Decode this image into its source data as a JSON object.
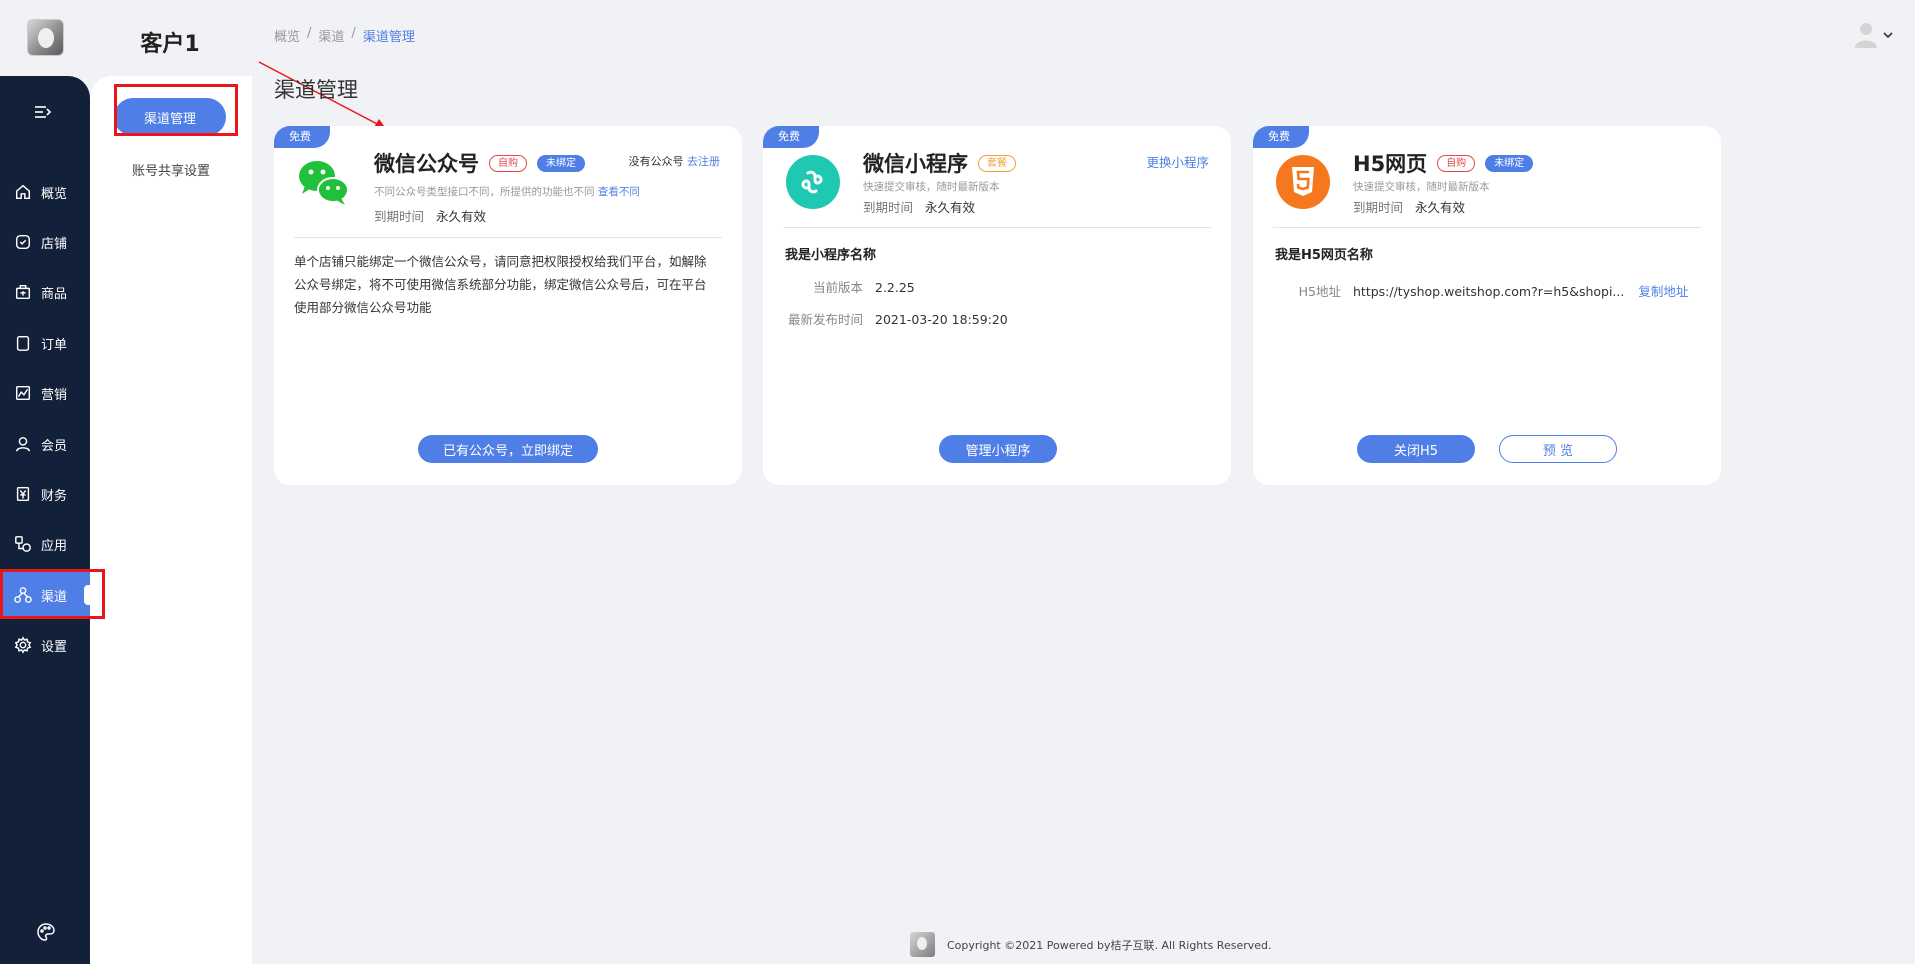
{
  "brand": {
    "store_name": "客户1"
  },
  "sidebar": {
    "items": [
      {
        "label": "概览",
        "icon": "home-icon"
      },
      {
        "label": "店铺",
        "icon": "shop-icon"
      },
      {
        "label": "商品",
        "icon": "goods-icon"
      },
      {
        "label": "订单",
        "icon": "order-icon"
      },
      {
        "label": "营销",
        "icon": "chart-icon"
      },
      {
        "label": "会员",
        "icon": "user-icon"
      },
      {
        "label": "财务",
        "icon": "yen-icon"
      },
      {
        "label": "应用",
        "icon": "apps-icon"
      },
      {
        "label": "渠道",
        "icon": "channel-icon",
        "active": true
      },
      {
        "label": "设置",
        "icon": "gear-icon"
      }
    ]
  },
  "subnav": {
    "active_label": "渠道管理",
    "items": [
      "账号共享设置"
    ]
  },
  "breadcrumb": {
    "items": [
      "概览",
      "渠道",
      "渠道管理"
    ],
    "separator": "/"
  },
  "page": {
    "title": "渠道管理"
  },
  "cards": {
    "wechat": {
      "free_tag": "免费",
      "title": "微信公众号",
      "tag_self": "自购",
      "tag_status": "未绑定",
      "no_account_text": "没有公众号",
      "register_link": "去注册",
      "subtitle": "不同公众号类型接口不同，所提供的功能也不同",
      "subtitle_link": "查看不同",
      "expire_label": "到期时间",
      "expire_value": "永久有效",
      "description": "单个店铺只能绑定一个微信公众号，请同意把权限授权给我们平台，如解除公众号绑定，将不可使用微信系统部分功能，绑定微信公众号后，可在平台使用部分微信公众号功能",
      "button": "已有公众号，立即绑定"
    },
    "miniprogram": {
      "free_tag": "免费",
      "title": "微信小程序",
      "tag_package": "套餐",
      "switch_link": "更换小程序",
      "subtitle": "快速提交审核，随时最新版本",
      "expire_label": "到期时间",
      "expire_value": "永久有效",
      "name": "我是小程序名称",
      "version_label": "当前版本",
      "version_value": "2.2.25",
      "publish_label": "最新发布时间",
      "publish_value": "2021-03-20 18:59:20",
      "button": "管理小程序"
    },
    "h5": {
      "free_tag": "免费",
      "title": "H5网页",
      "tag_self": "自购",
      "tag_status": "未绑定",
      "subtitle": "快速提交审核，随时最新版本",
      "expire_label": "到期时间",
      "expire_value": "永久有效",
      "name": "我是H5网页名称",
      "url_label": "H5地址",
      "url_value": "https://tyshop.weitshop.com?r=h5&shopi...",
      "copy_link": "复制地址",
      "button_close": "关闭H5",
      "button_preview": "预 览"
    }
  },
  "footer": {
    "copyright": "Copyright ©2021 Powered by桔子互联. All Rights Reserved."
  },
  "colors": {
    "accent": "#4f7fe6",
    "sidebar_bg": "#13203a",
    "annotation_red": "#e8161a"
  }
}
